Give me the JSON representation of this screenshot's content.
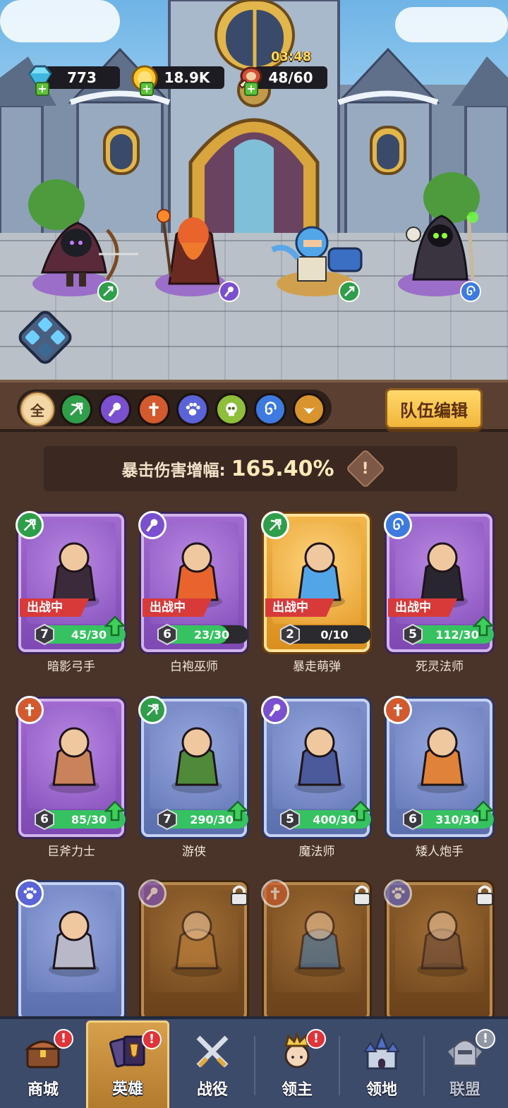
{
  "resources": {
    "diamond": "773",
    "gold": "18.9K",
    "stamina": "48/60",
    "stamina_timer": "03:48"
  },
  "filters": {
    "all_label": "全",
    "team_edit_label": "队伍编辑",
    "items": [
      "all",
      "archer",
      "mage",
      "warrior",
      "beast",
      "undead",
      "spiral",
      "wings"
    ]
  },
  "crit": {
    "label": "暴击伤害增幅:",
    "value": "165.40%"
  },
  "heroes": [
    {
      "name": "暗影弓手",
      "level": "7",
      "progress": "45/30",
      "deployed": "出战中",
      "class": "archer",
      "frame": "purple",
      "upgrade": true
    },
    {
      "name": "白袍巫师",
      "level": "6",
      "progress": "23/30",
      "deployed": "出战中",
      "class": "mage",
      "frame": "purple",
      "upgrade": false
    },
    {
      "name": "暴走萌弹",
      "level": "2",
      "progress": "0/10",
      "deployed": "出战中",
      "class": "archer",
      "frame": "gold",
      "upgrade": false
    },
    {
      "name": "死灵法师",
      "level": "5",
      "progress": "112/30",
      "deployed": "出战中",
      "class": "spiral",
      "frame": "purple",
      "upgrade": true
    },
    {
      "name": "巨斧力士",
      "level": "6",
      "progress": "85/30",
      "class": "warrior",
      "frame": "purple",
      "upgrade": true
    },
    {
      "name": "游侠",
      "level": "7",
      "progress": "290/30",
      "class": "archer",
      "frame": "blue",
      "upgrade": true
    },
    {
      "name": "魔法师",
      "level": "5",
      "progress": "400/30",
      "class": "mage",
      "frame": "blue",
      "upgrade": true
    },
    {
      "name": "矮人炮手",
      "level": "6",
      "progress": "310/30",
      "class": "warrior",
      "frame": "blue",
      "upgrade": true
    },
    {
      "class": "beast",
      "frame": "blue",
      "locked": false
    },
    {
      "class": "mage",
      "frame": "locked",
      "locked": true
    },
    {
      "class": "warrior",
      "frame": "locked",
      "locked": true
    },
    {
      "class": "beast",
      "frame": "locked",
      "locked": true
    }
  ],
  "nav": [
    {
      "label": "商城",
      "alert": "!"
    },
    {
      "label": "英雄",
      "alert": "!"
    },
    {
      "label": "战役",
      "alert": ""
    },
    {
      "label": "领主",
      "alert": "!"
    },
    {
      "label": "领地",
      "alert": ""
    },
    {
      "label": "联盟",
      "alert": "!"
    }
  ],
  "colors": {
    "archer": "#2f9e4a",
    "mage": "#7a4fd0",
    "warrior": "#d25a2e",
    "beast": "#5a63d8",
    "undead": "#8fbf3a",
    "spiral": "#3d7be0",
    "wings": "#d9942e"
  }
}
